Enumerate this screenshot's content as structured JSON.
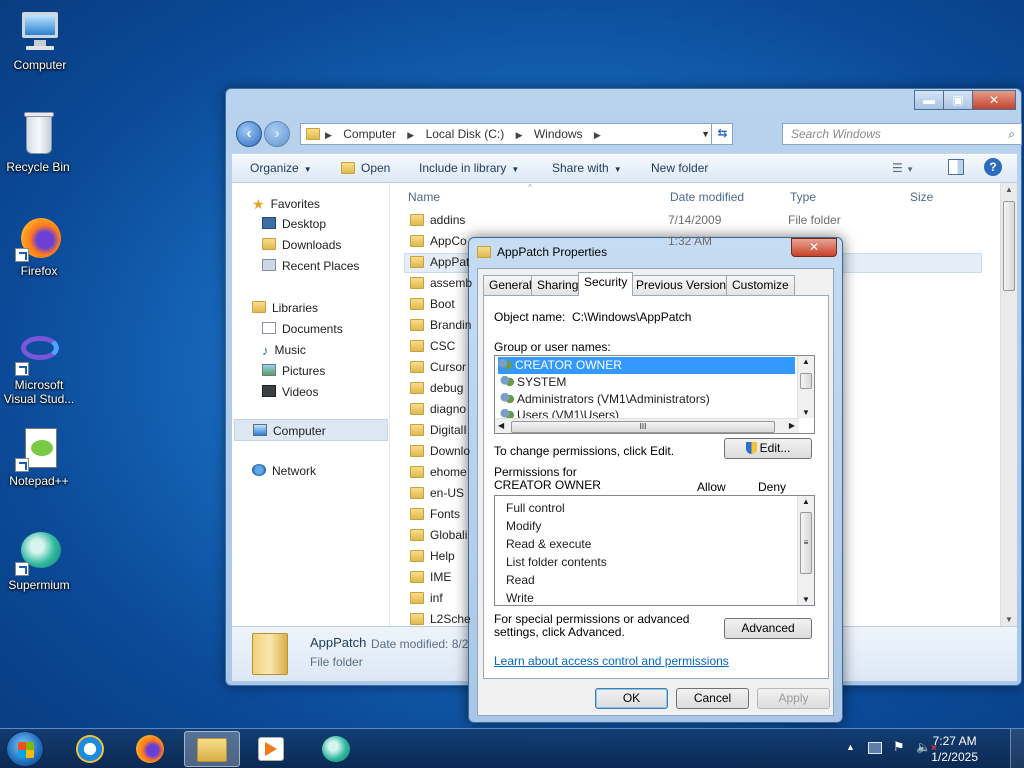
{
  "desktop": {
    "icons": [
      {
        "label": "Computer"
      },
      {
        "label": "Recycle Bin"
      },
      {
        "label": "Firefox"
      },
      {
        "label": "Microsoft Visual Stud..."
      },
      {
        "label": "Notepad++"
      },
      {
        "label": "Supermium"
      }
    ]
  },
  "explorer": {
    "controls": {
      "minimize": "▬",
      "maximize": "▣",
      "close": "✕"
    },
    "address": {
      "segments": [
        "Computer",
        "Local Disk (C:)",
        "Windows"
      ]
    },
    "search": {
      "placeholder": "Search Windows"
    },
    "toolbar": {
      "organize": "Organize",
      "open": "Open",
      "include_in_library": "Include in library",
      "share_with": "Share with",
      "new_folder": "New folder"
    },
    "nav": {
      "favorites": "Favorites",
      "desktop": "Desktop",
      "downloads": "Downloads",
      "recent_places": "Recent Places",
      "libraries": "Libraries",
      "documents": "Documents",
      "music": "Music",
      "pictures": "Pictures",
      "videos": "Videos",
      "computer": "Computer",
      "network": "Network"
    },
    "columns": {
      "name": "Name",
      "date_modified": "Date modified",
      "type": "Type",
      "size": "Size"
    },
    "files": [
      {
        "name": "addins",
        "date": "7/14/2009 1:32 AM",
        "type": "File folder"
      },
      {
        "name": "AppCo"
      },
      {
        "name": "AppPat"
      },
      {
        "name": "assemb"
      },
      {
        "name": "Boot"
      },
      {
        "name": "Brandin"
      },
      {
        "name": "CSC"
      },
      {
        "name": "Cursor"
      },
      {
        "name": "debug"
      },
      {
        "name": "diagno"
      },
      {
        "name": "DigitalI"
      },
      {
        "name": "Downlo"
      },
      {
        "name": "ehome"
      },
      {
        "name": "en-US"
      },
      {
        "name": "Fonts"
      },
      {
        "name": "Globali"
      },
      {
        "name": "Help"
      },
      {
        "name": "IME"
      },
      {
        "name": "inf"
      },
      {
        "name": "L2Sche"
      }
    ],
    "details": {
      "name": "AppPatch",
      "date_label": "Date modified: 8/2",
      "type": "File folder"
    }
  },
  "dialog": {
    "title": "AppPatch Properties",
    "close": "✕",
    "tabs": [
      "General",
      "Sharing",
      "Security",
      "Previous Versions",
      "Customize"
    ],
    "active_tab": "Security",
    "object_name_label": "Object name:",
    "object_name_value": "C:\\Windows\\AppPatch",
    "group_label": "Group or user names:",
    "groups": [
      "CREATOR OWNER",
      "SYSTEM",
      "Administrators (VM1\\Administrators)",
      "Users (VM1\\Users)"
    ],
    "hscroll_grip": "III",
    "change_text": "To change permissions, click Edit.",
    "edit_button": "Edit...",
    "permissions_for": "Permissions for CREATOR OWNER",
    "allow": "Allow",
    "deny": "Deny",
    "permissions": [
      "Full control",
      "Modify",
      "Read & execute",
      "List folder contents",
      "Read",
      "Write"
    ],
    "special_text": "For special permissions or advanced settings, click Advanced.",
    "advanced_button": "Advanced",
    "learn_link": "Learn about access control and permissions",
    "ok": "OK",
    "cancel": "Cancel",
    "apply": "Apply"
  },
  "taskbar": {
    "time": "7:27 AM",
    "date": "1/2/2025",
    "show_hidden": "▲"
  },
  "colors": {
    "selection": "#3399ff",
    "link": "#0066cc",
    "accent": "#3b6a9c"
  }
}
